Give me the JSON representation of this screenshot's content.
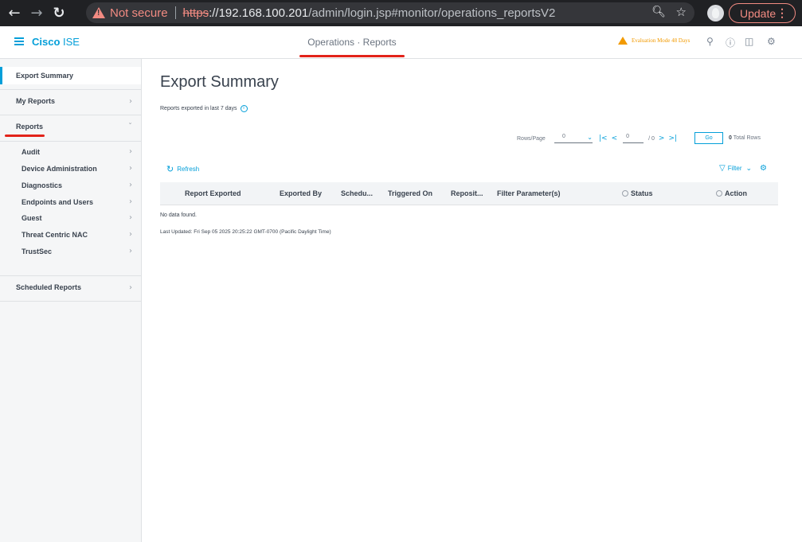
{
  "browser": {
    "not_secure": "Not secure",
    "url_proto": "https",
    "url_host": "://192.168.100.201",
    "url_path": "/admin/login.jsp#monitor/operations_reportsV2",
    "update_label": "Update"
  },
  "header": {
    "brand_bold": "Cisco",
    "brand_light": " ISE",
    "page_heading": "Operations · Reports",
    "eval_text": "Evaluation Mode 48 Days"
  },
  "sidebar": {
    "export_summary": "Export Summary",
    "my_reports": "My Reports",
    "reports": "Reports",
    "sub_items": [
      "Audit",
      "Device Administration",
      "Diagnostics",
      "Endpoints and Users",
      "Guest",
      "Threat Centric NAC",
      "TrustSec"
    ],
    "scheduled_reports": "Scheduled Reports"
  },
  "main": {
    "title": "Export Summary",
    "subtitle": "Reports exported in last 7 days",
    "pager": {
      "rows_label": "Rows/Page",
      "rows_value": "0",
      "page_value": "0",
      "page_total": "/ 0",
      "go_label": "Go",
      "total_count": "0",
      "total_label": "Total Rows"
    },
    "refresh_label": "Refresh",
    "filter_label": "Filter",
    "columns": [
      "Report Exported",
      "Exported By",
      "Schedu...",
      "Triggered On",
      "Reposit...",
      "Filter Parameter(s)",
      "Status",
      "Action"
    ],
    "no_data": "No data found.",
    "last_updated": "Last Updated: Fri Sep 05 2025 20:25:22 GMT-0700 (Pacific Daylight Time)"
  },
  "colors": {
    "accent": "#049fd9",
    "active_marker": "#e2231a",
    "warning": "#f29a00"
  }
}
